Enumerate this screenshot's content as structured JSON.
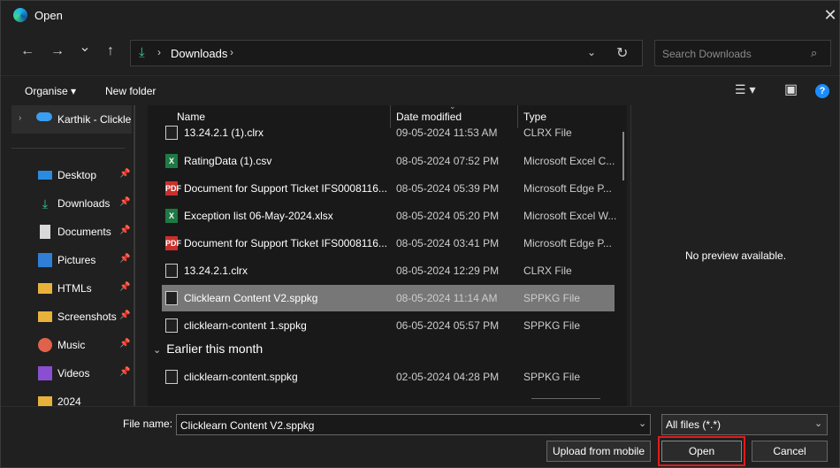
{
  "window": {
    "title": "Open",
    "close_symbol": "✕"
  },
  "nav": {
    "back_symbol": "←",
    "forward_symbol": "→",
    "recent_symbol": "⌄",
    "up_symbol": "↑",
    "breadcrumb_sep": "›",
    "breadcrumb": "Downloads",
    "address_dropdown_symbol": "⌄",
    "refresh_symbol": "↻",
    "search_placeholder": "Search Downloads",
    "search_icon_symbol": "⌕"
  },
  "toolbar": {
    "organise": "Organise ▾",
    "new_folder": "New folder",
    "view_symbol": "☰ ▾",
    "pane_symbol": "▣",
    "help_symbol": "?"
  },
  "sidebar": {
    "top": {
      "expand_symbol": "›",
      "label": "Karthik - Clickle"
    },
    "pin_symbol": "📌",
    "items": [
      {
        "label": "Desktop",
        "icon": "desktop-icon"
      },
      {
        "label": "Downloads",
        "icon": "downloads-icon"
      },
      {
        "label": "Documents",
        "icon": "documents-icon"
      },
      {
        "label": "Pictures",
        "icon": "pictures-icon"
      },
      {
        "label": "HTMLs",
        "icon": "folder-icon"
      },
      {
        "label": "Screenshots",
        "icon": "folder-icon"
      },
      {
        "label": "Music",
        "icon": "music-icon"
      },
      {
        "label": "Videos",
        "icon": "videos-icon"
      },
      {
        "label": "2024",
        "icon": "folder-icon"
      }
    ]
  },
  "columns": {
    "name": "Name",
    "date": "Date modified",
    "type": "Type"
  },
  "files": [
    {
      "name": "13.24.2.1 (1).clrx",
      "date": "09-05-2024 11:53 AM",
      "type": "CLRX File",
      "icon": "file-icon"
    },
    {
      "name": "RatingData (1).csv",
      "date": "08-05-2024 07:52 PM",
      "type": "Microsoft Excel C...",
      "icon": "excel-icon"
    },
    {
      "name": "Document for Support Ticket IFS0008116...",
      "date": "08-05-2024 05:39 PM",
      "type": "Microsoft Edge P...",
      "icon": "pdf-icon"
    },
    {
      "name": "Exception list 06-May-2024.xlsx",
      "date": "08-05-2024 05:20 PM",
      "type": "Microsoft Excel W...",
      "icon": "excel-icon"
    },
    {
      "name": "Document for Support Ticket IFS0008116...",
      "date": "08-05-2024 03:41 PM",
      "type": "Microsoft Edge P...",
      "icon": "pdf-icon"
    },
    {
      "name": "13.24.2.1.clrx",
      "date": "08-05-2024 12:29 PM",
      "type": "CLRX File",
      "icon": "file-icon"
    },
    {
      "name": "Clicklearn Content V2.sppkg",
      "date": "08-05-2024 11:14 AM",
      "type": "SPPKG File",
      "icon": "file-icon",
      "selected": true
    },
    {
      "name": "clicklearn-content 1.sppkg",
      "date": "06-05-2024 05:57 PM",
      "type": "SPPKG File",
      "icon": "file-icon"
    }
  ],
  "group_earlier": {
    "expand_symbol": "⌄",
    "label": "Earlier this month"
  },
  "files_earlier": [
    {
      "name": "clicklearn-content.sppkg",
      "date": "02-05-2024 04:28 PM",
      "type": "SPPKG File",
      "icon": "file-icon"
    }
  ],
  "preview": {
    "message": "No preview available."
  },
  "bottom": {
    "file_name_label": "File name:",
    "file_name_value": "Clicklearn Content V2.sppkg",
    "dropdown_symbol": "⌄",
    "file_type_value": "All files (*.*)",
    "upload_button": "Upload from mobile",
    "open_button": "Open",
    "cancel_button": "Cancel"
  },
  "colors": {
    "highlight_outline": "#e21b1b",
    "selected_row": "#777777",
    "accent": "#1a8cff"
  }
}
